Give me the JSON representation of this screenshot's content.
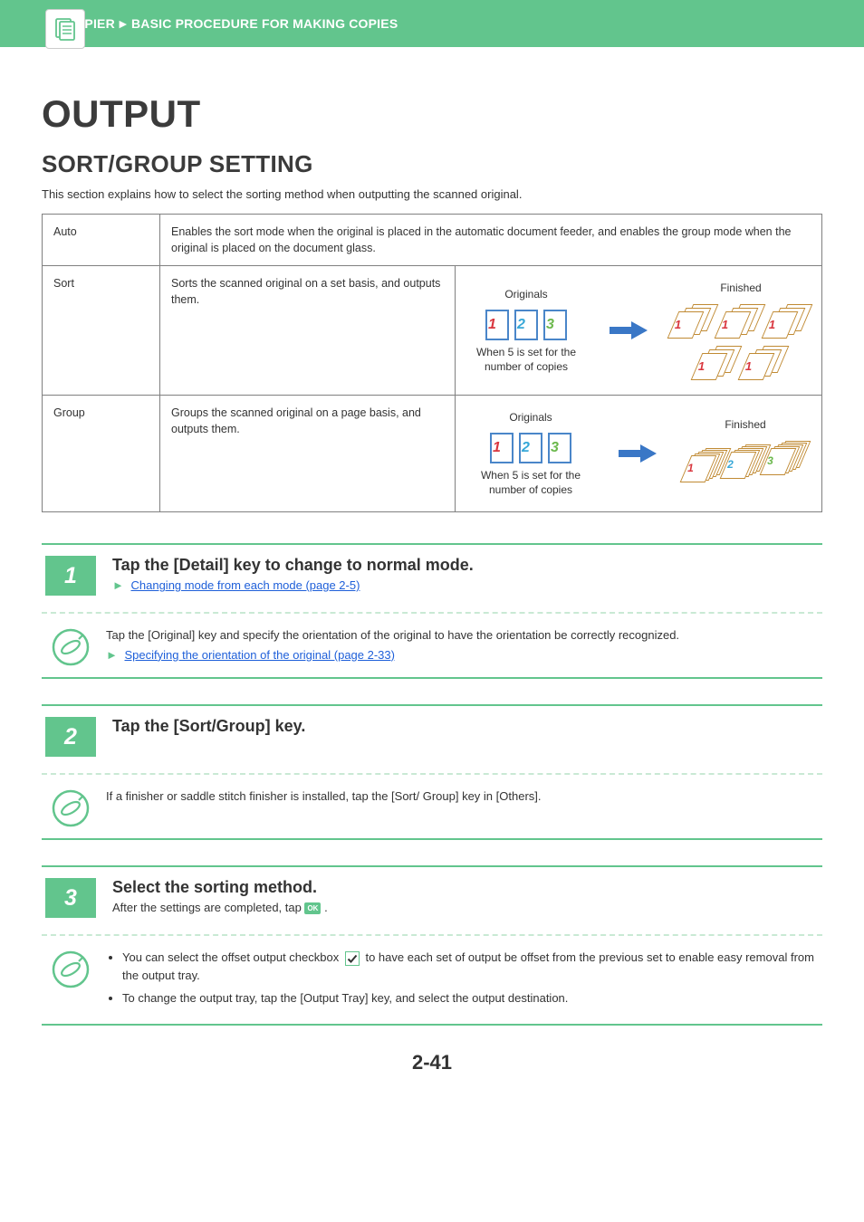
{
  "header": {
    "breadcrumb_part1": "COPIER",
    "breadcrumb_part2": "BASIC PROCEDURE FOR MAKING COPIES"
  },
  "title_h1": "OUTPUT",
  "title_h2": "SORT/GROUP SETTING",
  "intro": "This section explains how to select the sorting method when outputting the scanned original.",
  "table": {
    "auto": {
      "label": "Auto",
      "desc": "Enables the sort mode when the original is placed in the automatic document feeder, and enables the group mode when the original is placed on the document glass."
    },
    "sort": {
      "label": "Sort",
      "desc": "Sorts the scanned original on a set basis, and outputs them.",
      "originals_label": "Originals",
      "finished_label": "Finished",
      "caption": "When 5 is set for the number of copies"
    },
    "group": {
      "label": "Group",
      "desc": "Groups the scanned original on a page basis, and outputs them.",
      "originals_label": "Originals",
      "finished_label": "Finished",
      "caption": "When 5 is set for the number of copies"
    },
    "page_numbers": {
      "p1": "1",
      "p2": "2",
      "p3": "3"
    }
  },
  "steps": {
    "s1": {
      "num": "1",
      "title": "Tap the [Detail] key to change to normal mode.",
      "link": "Changing mode from each mode (page 2-5)",
      "note_text": "Tap the [Original] key and specify the orientation of the original to have the orientation be correctly recognized.",
      "note_link": "Specifying the orientation of the original (page 2-33)"
    },
    "s2": {
      "num": "2",
      "title": "Tap the [Sort/Group] key.",
      "note_text": "If a finisher or saddle stitch finisher is installed, tap the [Sort/ Group] key in [Others]."
    },
    "s3": {
      "num": "3",
      "title": "Select the sorting method.",
      "sub_pre": "After the settings are completed, tap ",
      "sub_post": ".",
      "ok_label": "OK",
      "bullet1_pre": "You can select the offset output checkbox ",
      "bullet1_post": " to have each set of output be offset from the previous set to enable easy removal from the output tray.",
      "bullet2": "To change the output tray, tap the [Output Tray] key, and select the output destination."
    }
  },
  "page_number": "2-41"
}
